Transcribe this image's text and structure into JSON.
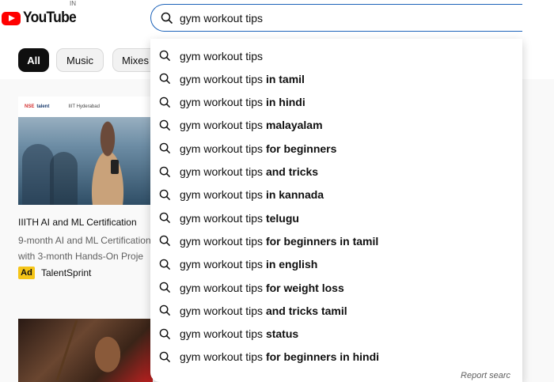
{
  "header": {
    "logo_text": "YouTube",
    "country_code": "IN",
    "search": {
      "value": "gym workout tips"
    }
  },
  "chips": [
    "All",
    "Music",
    "Mixes"
  ],
  "videos": [
    {
      "title": "IIITH AI and ML Certification",
      "description_line1": "9-month AI and ML Certification",
      "description_line2": "with 3-month Hands-On Proje",
      "ad_label": "Ad",
      "advertiser": "TalentSprint",
      "thumbnail": {
        "nse_text": "NSE",
        "talent_text": "talent",
        "iit_text": "IIIT Hyderabad"
      }
    }
  ],
  "suggestions": [
    {
      "base": "gym workout tips",
      "bold": ""
    },
    {
      "base": "gym workout tips ",
      "bold": "in tamil"
    },
    {
      "base": "gym workout tips ",
      "bold": "in hindi"
    },
    {
      "base": "gym workout tips ",
      "bold": "malayalam"
    },
    {
      "base": "gym workout tips ",
      "bold": "for beginners"
    },
    {
      "base": "gym workout tips ",
      "bold": "and tricks"
    },
    {
      "base": "gym workout tips ",
      "bold": "in kannada"
    },
    {
      "base": "gym workout tips ",
      "bold": "telugu"
    },
    {
      "base": "gym workout tips ",
      "bold": "for beginners in tamil"
    },
    {
      "base": "gym workout tips ",
      "bold": "in english"
    },
    {
      "base": "gym workout tips ",
      "bold": "for weight loss"
    },
    {
      "base": "gym workout tips ",
      "bold": "and tricks tamil"
    },
    {
      "base": "gym workout tips ",
      "bold": "status"
    },
    {
      "base": "gym workout tips ",
      "bold": "for beginners in hindi"
    }
  ],
  "report_text": "Report searc",
  "colors": {
    "brand_red": "#ff0000",
    "search_border": "#1c62b9",
    "ad_badge": "#f5c518"
  },
  "icons": {
    "suggestion": "search-icon",
    "logo": "youtube-play-icon"
  }
}
